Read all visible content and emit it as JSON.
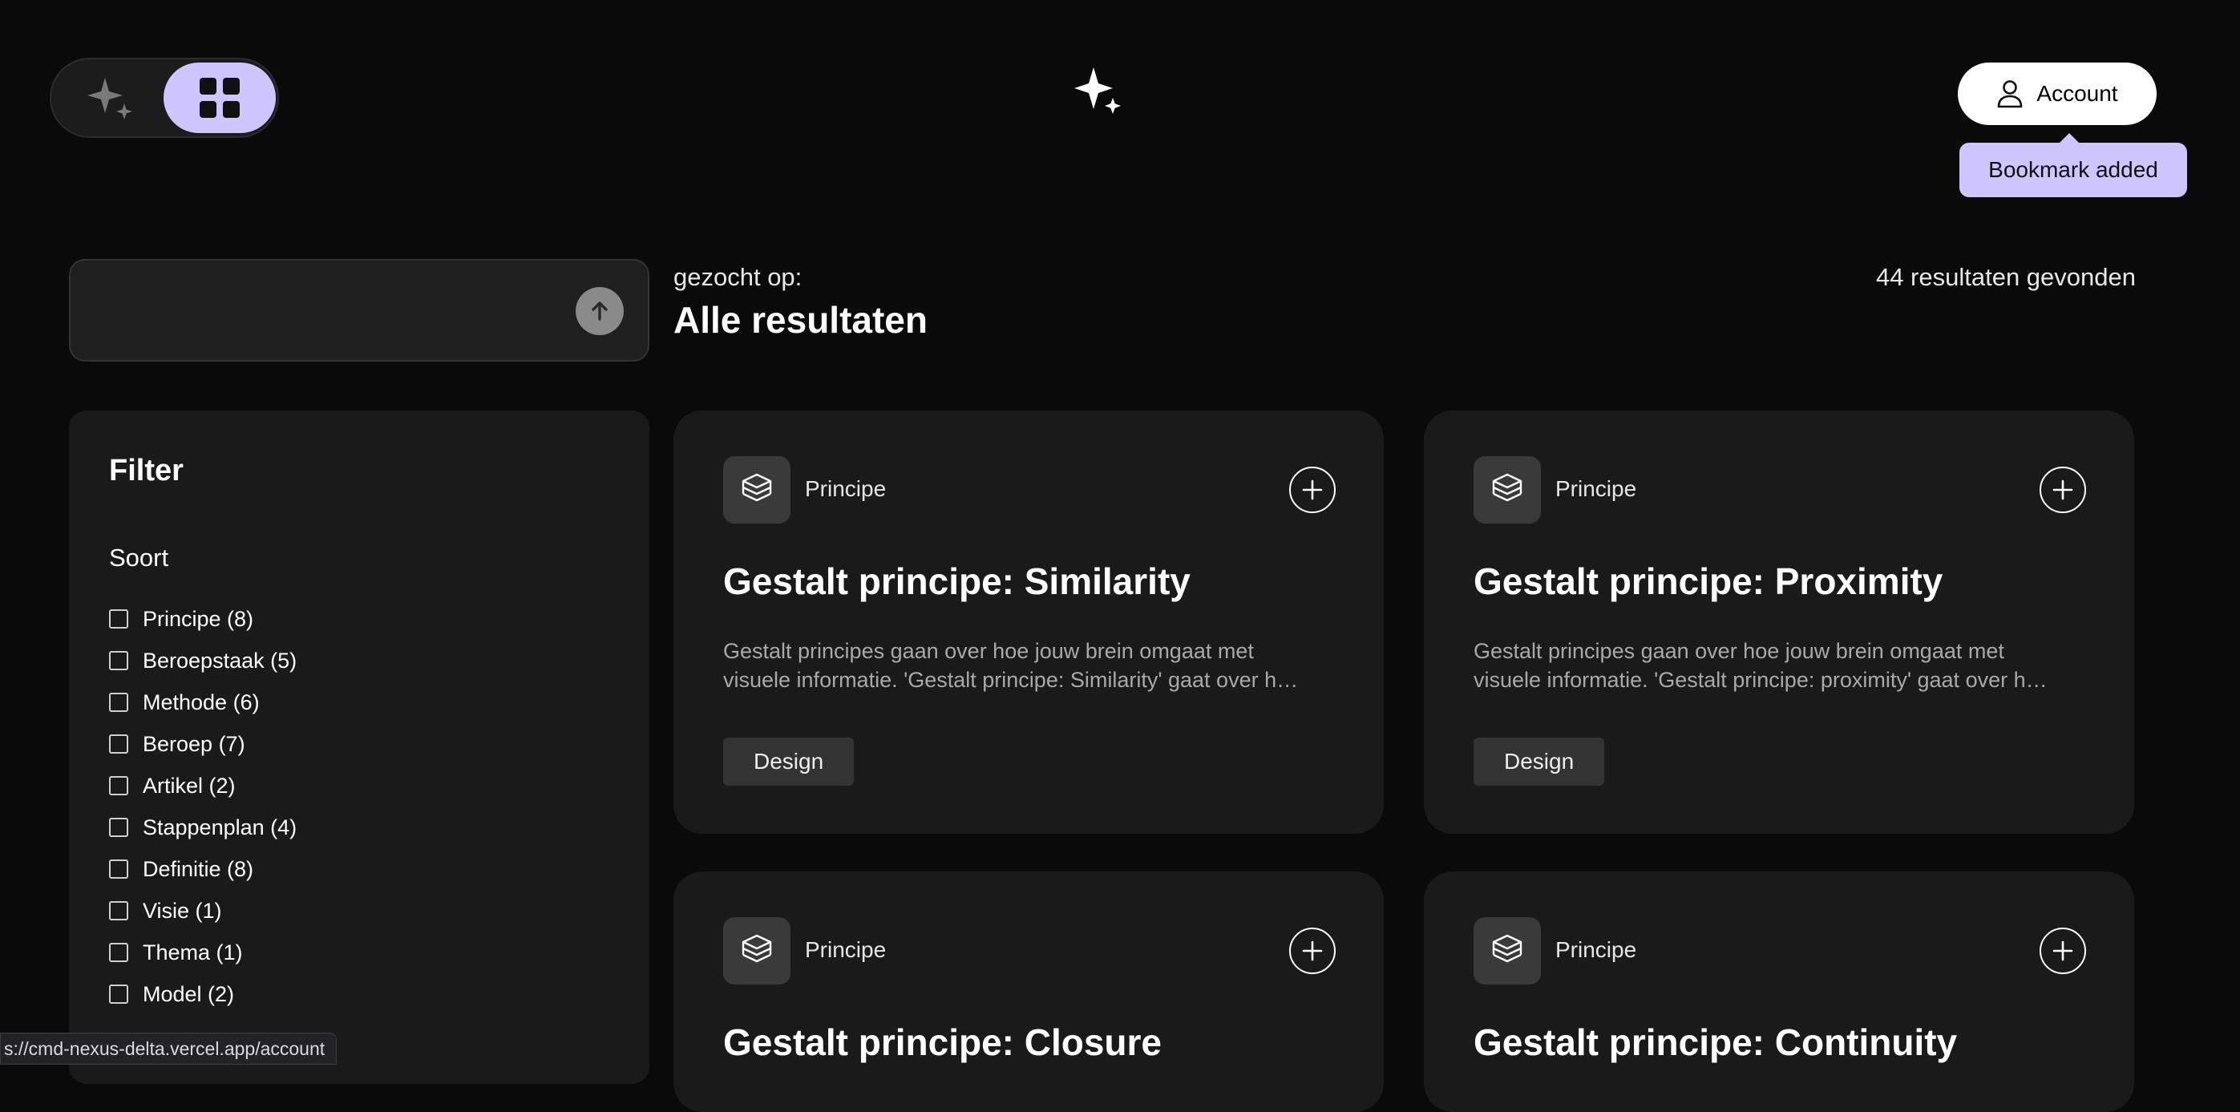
{
  "header": {
    "account_label": "Account",
    "toast": "Bookmark added"
  },
  "search": {
    "placeholder": "",
    "label": "gezocht op:",
    "query": "Alle resultaten",
    "result_count": "44 resultaten gevonden"
  },
  "filter": {
    "title": "Filter",
    "section_title": "Soort",
    "items": [
      {
        "label": "Principe (8)"
      },
      {
        "label": "Beroepstaak (5)"
      },
      {
        "label": "Methode (6)"
      },
      {
        "label": "Beroep (7)"
      },
      {
        "label": "Artikel (2)"
      },
      {
        "label": "Stappenplan (4)"
      },
      {
        "label": "Definitie (8)"
      },
      {
        "label": "Visie (1)"
      },
      {
        "label": "Thema (1)"
      },
      {
        "label": "Model (2)"
      }
    ]
  },
  "cards": [
    {
      "type": "Principe",
      "title": "Gestalt principe: Similarity",
      "description": "Gestalt principes gaan over hoe jouw brein omgaat met visuele informatie. 'Gestalt principe: Similarity' gaat over hoe we dingen die op elkaar lijken als groep zien.",
      "tag": "Design"
    },
    {
      "type": "Principe",
      "title": "Gestalt principe: Proximity",
      "description": "Gestalt principes gaan over hoe jouw brein omgaat met visuele informatie. 'Gestalt principe: proximity' gaat over hoe we dingen die dicht bij elkaar staan als groep zien.",
      "tag": "Design"
    },
    {
      "type": "Principe",
      "title": "Gestalt principe: Closure"
    },
    {
      "type": "Principe",
      "title": "Gestalt principe: Continuity"
    }
  ],
  "statusbar": {
    "url": "s://cmd-nexus-delta.vercel.app/account"
  },
  "colors": {
    "background": "#0a0a0a",
    "panel": "#1a1a1a",
    "accent": "#cfc5ff"
  },
  "icons": {
    "ai_toggle": "sparkle-icon",
    "grid_toggle": "grid-icon",
    "logo": "sparkle-logo-icon",
    "account": "user-icon",
    "search_submit": "arrow-up-icon",
    "card_type": "layers-icon",
    "card_add": "plus-circle-icon"
  }
}
